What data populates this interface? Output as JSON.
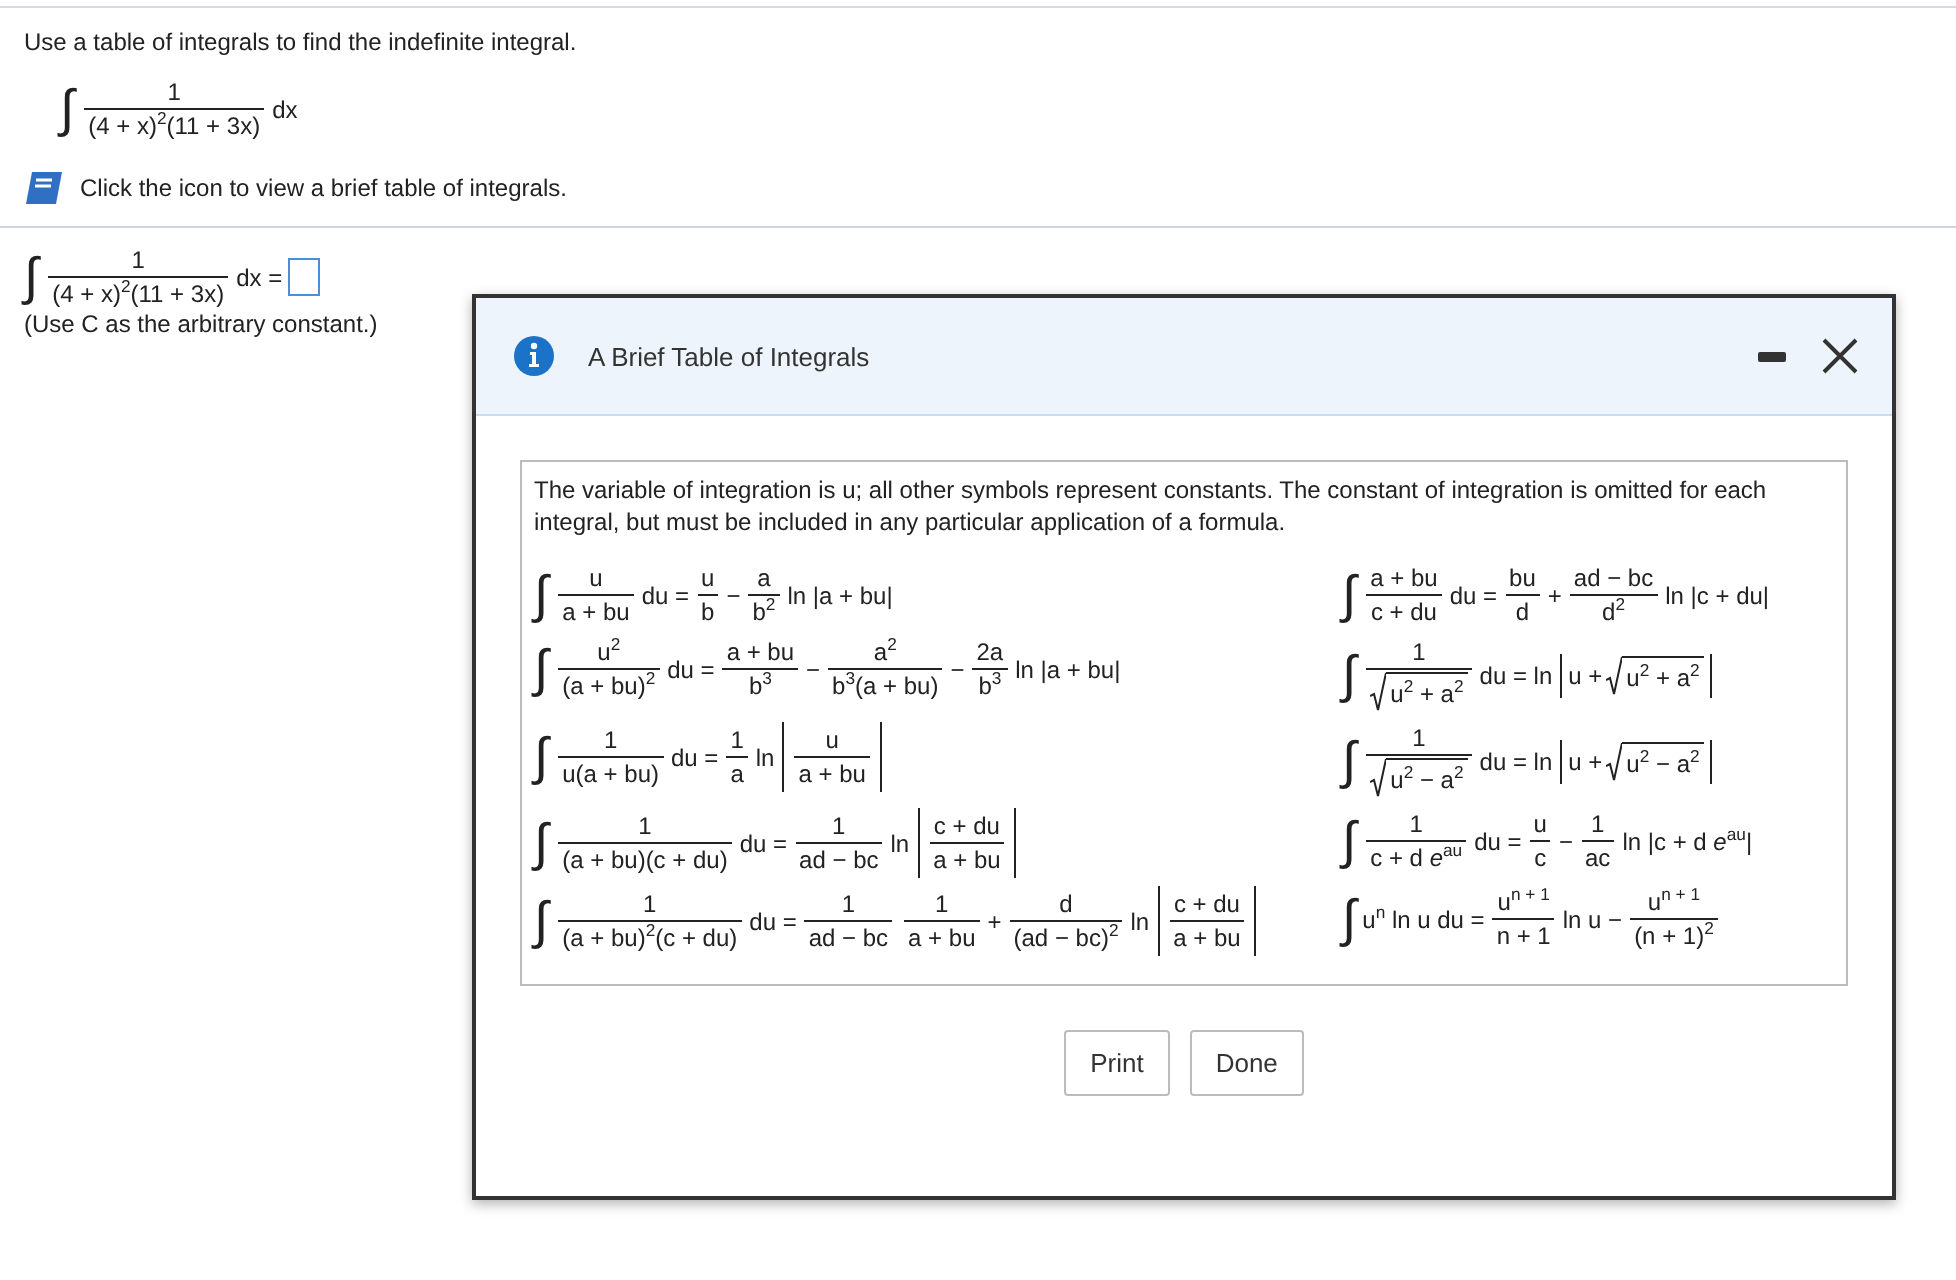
{
  "question": {
    "prompt": "Use a table of integrals to find the indefinite integral.",
    "integral": [
      {
        "kind": "int",
        "text": "∫"
      },
      {
        "kind": "frac",
        "num": [
          {
            "kind": "text",
            "text": "1"
          }
        ],
        "den": [
          {
            "kind": "text",
            "text": "(4 + x)$^{2}$(11 + 3x)"
          }
        ]
      },
      {
        "kind": "text",
        "text": "dx"
      }
    ]
  },
  "table_link": {
    "text": "Click the icon to view a brief table of integrals."
  },
  "answer": {
    "integral": [
      {
        "kind": "int",
        "text": "∫"
      },
      {
        "kind": "frac",
        "num": [
          {
            "kind": "text",
            "text": "1"
          }
        ],
        "den": [
          {
            "kind": "text",
            "text": "(4 + x)$^{2}$(11 + 3x)"
          }
        ]
      },
      {
        "kind": "text",
        "text": "dx ="
      }
    ],
    "note": "(Use C as the arbitrary constant.)"
  },
  "dialog": {
    "title": "A Brief Table of Integrals",
    "intro": "The variable of integration is u; all other symbols represent constants. The constant of integration is omitted for each integral, but must be included in any particular application of a formula.",
    "formulas": [
      [
        {
          "kind": "int",
          "text": "∫"
        },
        {
          "kind": "frac",
          "num": [
            {
              "kind": "text",
              "text": "u"
            }
          ],
          "den": [
            {
              "kind": "text",
              "text": "a + bu"
            }
          ]
        },
        {
          "kind": "text",
          "text": "du ="
        },
        {
          "kind": "frac",
          "num": [
            {
              "kind": "text",
              "text": "u"
            }
          ],
          "den": [
            {
              "kind": "text",
              "text": "b"
            }
          ]
        },
        {
          "kind": "text",
          "text": "−"
        },
        {
          "kind": "frac",
          "num": [
            {
              "kind": "text",
              "text": "a"
            }
          ],
          "den": [
            {
              "kind": "text",
              "text": "b$^{2}$"
            }
          ]
        },
        {
          "kind": "text",
          "text": "ln |a + bu|"
        }
      ],
      [
        {
          "kind": "int",
          "text": "∫"
        },
        {
          "kind": "frac",
          "num": [
            {
              "kind": "text",
              "text": "a + bu"
            }
          ],
          "den": [
            {
              "kind": "text",
              "text": "c + du"
            }
          ]
        },
        {
          "kind": "text",
          "text": "du ="
        },
        {
          "kind": "frac",
          "num": [
            {
              "kind": "text",
              "text": "bu"
            }
          ],
          "den": [
            {
              "kind": "text",
              "text": "d"
            }
          ]
        },
        {
          "kind": "text",
          "text": "+"
        },
        {
          "kind": "frac",
          "num": [
            {
              "kind": "text",
              "text": "ad − bc"
            }
          ],
          "den": [
            {
              "kind": "text",
              "text": "d$^{2}$"
            }
          ]
        },
        {
          "kind": "text",
          "text": "ln |c + du|"
        }
      ],
      [
        {
          "kind": "int",
          "text": "∫"
        },
        {
          "kind": "frac",
          "num": [
            {
              "kind": "text",
              "text": "u$^{2}$"
            }
          ],
          "den": [
            {
              "kind": "text",
              "text": "(a + bu)$^{2}$"
            }
          ]
        },
        {
          "kind": "text",
          "text": "du ="
        },
        {
          "kind": "frac",
          "num": [
            {
              "kind": "text",
              "text": "a + bu"
            }
          ],
          "den": [
            {
              "kind": "text",
              "text": "b$^{3}$"
            }
          ]
        },
        {
          "kind": "text",
          "text": "−"
        },
        {
          "kind": "frac",
          "num": [
            {
              "kind": "text",
              "text": "a$^{2}$"
            }
          ],
          "den": [
            {
              "kind": "text",
              "text": "b$^{3}$(a + bu)"
            }
          ]
        },
        {
          "kind": "text",
          "text": "−"
        },
        {
          "kind": "frac",
          "num": [
            {
              "kind": "text",
              "text": "2a"
            }
          ],
          "den": [
            {
              "kind": "text",
              "text": "b$^{3}$"
            }
          ]
        },
        {
          "kind": "text",
          "text": "ln |a + bu|"
        }
      ],
      [
        {
          "kind": "int",
          "text": "∫"
        },
        {
          "kind": "frac",
          "num": [
            {
              "kind": "text",
              "text": "1"
            }
          ],
          "den": [
            {
              "kind": "sqrt",
              "body": [
                {
                  "kind": "text",
                  "text": "u$^{2}$ + a$^{2}$"
                }
              ]
            }
          ]
        },
        {
          "kind": "text",
          "text": "du = ln"
        },
        {
          "kind": "abs",
          "body": [
            {
              "kind": "text",
              "text": "u +"
            },
            {
              "kind": "sqrt",
              "body": [
                {
                  "kind": "text",
                  "text": "u$^{2}$ + a$^{2}$"
                }
              ]
            }
          ]
        }
      ],
      [
        {
          "kind": "int",
          "text": "∫"
        },
        {
          "kind": "frac",
          "num": [
            {
              "kind": "text",
              "text": "1"
            }
          ],
          "den": [
            {
              "kind": "text",
              "text": "u(a + bu)"
            }
          ]
        },
        {
          "kind": "text",
          "text": "du ="
        },
        {
          "kind": "frac",
          "num": [
            {
              "kind": "text",
              "text": "1"
            }
          ],
          "den": [
            {
              "kind": "text",
              "text": "a"
            }
          ]
        },
        {
          "kind": "text",
          "text": "ln"
        },
        {
          "kind": "abs",
          "body": [
            {
              "kind": "frac",
              "num": [
                {
                  "kind": "text",
                  "text": "u"
                }
              ],
              "den": [
                {
                  "kind": "text",
                  "text": "a + bu"
                }
              ]
            }
          ]
        }
      ],
      [
        {
          "kind": "int",
          "text": "∫"
        },
        {
          "kind": "frac",
          "num": [
            {
              "kind": "text",
              "text": "1"
            }
          ],
          "den": [
            {
              "kind": "sqrt",
              "body": [
                {
                  "kind": "text",
                  "text": "u$^{2}$ − a$^{2}$"
                }
              ]
            }
          ]
        },
        {
          "kind": "text",
          "text": "du = ln"
        },
        {
          "kind": "abs",
          "body": [
            {
              "kind": "text",
              "text": "u +"
            },
            {
              "kind": "sqrt",
              "body": [
                {
                  "kind": "text",
                  "text": "u$^{2}$ − a$^{2}$"
                }
              ]
            }
          ]
        }
      ],
      [
        {
          "kind": "int",
          "text": "∫"
        },
        {
          "kind": "frac",
          "num": [
            {
              "kind": "text",
              "text": "1"
            }
          ],
          "den": [
            {
              "kind": "text",
              "text": "(a + bu)(c + du)"
            }
          ]
        },
        {
          "kind": "text",
          "text": "du ="
        },
        {
          "kind": "frac",
          "num": [
            {
              "kind": "text",
              "text": "1"
            }
          ],
          "den": [
            {
              "kind": "text",
              "text": "ad − bc"
            }
          ]
        },
        {
          "kind": "text",
          "text": "ln"
        },
        {
          "kind": "abs",
          "body": [
            {
              "kind": "frac",
              "num": [
                {
                  "kind": "text",
                  "text": "c + du"
                }
              ],
              "den": [
                {
                  "kind": "text",
                  "text": "a + bu"
                }
              ]
            }
          ]
        }
      ],
      [
        {
          "kind": "int",
          "text": "∫"
        },
        {
          "kind": "frac",
          "num": [
            {
              "kind": "text",
              "text": "1"
            }
          ],
          "den": [
            {
              "kind": "text",
              "text": "c + d *e*$^{au}$"
            }
          ]
        },
        {
          "kind": "text",
          "text": "du ="
        },
        {
          "kind": "frac",
          "num": [
            {
              "kind": "text",
              "text": "u"
            }
          ],
          "den": [
            {
              "kind": "text",
              "text": "c"
            }
          ]
        },
        {
          "kind": "text",
          "text": "−"
        },
        {
          "kind": "frac",
          "num": [
            {
              "kind": "text",
              "text": "1"
            }
          ],
          "den": [
            {
              "kind": "text",
              "text": "ac"
            }
          ]
        },
        {
          "kind": "text",
          "text": "ln |c + d *e*$^{au}$|"
        }
      ],
      [
        {
          "kind": "int",
          "text": "∫"
        },
        {
          "kind": "frac",
          "num": [
            {
              "kind": "text",
              "text": "1"
            }
          ],
          "den": [
            {
              "kind": "text",
              "text": "(a + bu)$^{2}$(c + du)"
            }
          ]
        },
        {
          "kind": "text",
          "text": "du ="
        },
        {
          "kind": "frac",
          "num": [
            {
              "kind": "text",
              "text": "1"
            }
          ],
          "den": [
            {
              "kind": "text",
              "text": "ad − bc"
            }
          ]
        },
        {
          "kind": "frac",
          "num": [
            {
              "kind": "text",
              "text": "1"
            }
          ],
          "den": [
            {
              "kind": "text",
              "text": "a + bu"
            }
          ]
        },
        {
          "kind": "text",
          "text": "+"
        },
        {
          "kind": "frac",
          "num": [
            {
              "kind": "text",
              "text": "d"
            }
          ],
          "den": [
            {
              "kind": "text",
              "text": "(ad − bc)$^{2}$"
            }
          ]
        },
        {
          "kind": "text",
          "text": "ln"
        },
        {
          "kind": "abs",
          "body": [
            {
              "kind": "frac",
              "num": [
                {
                  "kind": "text",
                  "text": "c + du"
                }
              ],
              "den": [
                {
                  "kind": "text",
                  "text": "a + bu"
                }
              ]
            }
          ]
        }
      ],
      [
        {
          "kind": "int",
          "text": "∫"
        },
        {
          "kind": "text",
          "text": "u$^{n}$ ln u du ="
        },
        {
          "kind": "frac",
          "num": [
            {
              "kind": "text",
              "text": "u$^{n + 1}$"
            }
          ],
          "den": [
            {
              "kind": "text",
              "text": "n + 1"
            }
          ]
        },
        {
          "kind": "text",
          "text": "ln u −"
        },
        {
          "kind": "frac",
          "num": [
            {
              "kind": "text",
              "text": "u$^{n + 1}$"
            }
          ],
          "den": [
            {
              "kind": "text",
              "text": "(n + 1)$^{2}$"
            }
          ]
        }
      ]
    ],
    "buttons": [
      {
        "label": "Print"
      },
      {
        "label": "Done"
      }
    ]
  }
}
